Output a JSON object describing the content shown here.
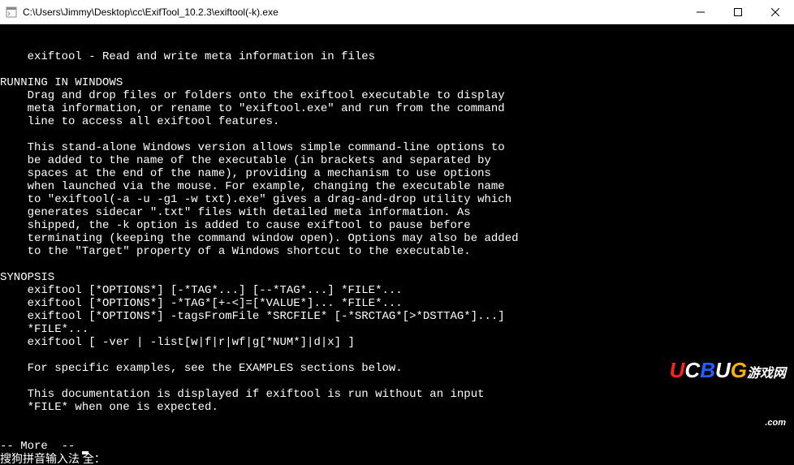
{
  "window": {
    "title": "C:\\Users\\Jimmy\\Desktop\\cc\\ExifTool_10.2.3\\exiftool(-k).exe"
  },
  "console": {
    "lines": [
      "    exiftool - Read and write meta information in files",
      "",
      "RUNNING IN WINDOWS",
      "    Drag and drop files or folders onto the exiftool executable to display",
      "    meta information, or rename to \"exiftool.exe\" and run from the command",
      "    line to access all exiftool features.",
      "",
      "    This stand-alone Windows version allows simple command-line options to",
      "    be added to the name of the executable (in brackets and separated by",
      "    spaces at the end of the name), providing a mechanism to use options",
      "    when launched via the mouse. For example, changing the executable name",
      "    to \"exiftool(-a -u -g1 -w txt).exe\" gives a drag-and-drop utility which",
      "    generates sidecar \".txt\" files with detailed meta information. As",
      "    shipped, the -k option is added to cause exiftool to pause before",
      "    terminating (keeping the command window open). Options may also be added",
      "    to the \"Target\" property of a Windows shortcut to the executable.",
      "",
      "SYNOPSIS",
      "    exiftool [*OPTIONS*] [-*TAG*...] [--*TAG*...] *FILE*...",
      "    exiftool [*OPTIONS*] -*TAG*[+-<]=[*VALUE*]... *FILE*...",
      "    exiftool [*OPTIONS*] -tagsFromFile *SRCFILE* [-*SRCTAG*[>*DSTTAG*]...]",
      "    *FILE*...",
      "    exiftool [ -ver | -list[w|f|r|wf|g[*NUM*]|d|x] ]",
      "",
      "    For specific examples, see the EXAMPLES sections below.",
      "",
      "    This documentation is displayed if exiftool is run without an input",
      "    *FILE* when one is expected."
    ],
    "more_prompt": "-- More  -- ",
    "ime_text": "搜狗拼音输入法 全："
  },
  "watermark": {
    "text_u": "U",
    "text_c": "C",
    "text_b": "B",
    "text_u2": "U",
    "text_g": "G",
    "text_cn": "游戏网",
    "sub": ".com"
  }
}
